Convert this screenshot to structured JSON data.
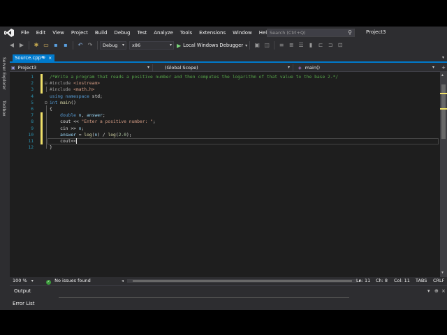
{
  "menu": {
    "items": [
      "File",
      "Edit",
      "View",
      "Project",
      "Build",
      "Debug",
      "Test",
      "Analyze",
      "Tools",
      "Extensions",
      "Window",
      "Help"
    ],
    "search_placeholder": "Search (Ctrl+Q)",
    "project_name": "Project3"
  },
  "toolbar": {
    "config": "Debug",
    "platform": "x86",
    "run_label": "Local Windows Debugger"
  },
  "side": {
    "server_explorer": "Server Explorer",
    "toolbox": "Toolbox"
  },
  "tab": {
    "label": "Source.cpp*",
    "pin": "⊕",
    "close": "×"
  },
  "navbar": {
    "project": "Project3",
    "scope": "(Global Scope)",
    "member": "main()"
  },
  "editor": {
    "line_numbers": [
      "1",
      "2",
      "3",
      "4",
      "5",
      "6",
      "7",
      "8",
      "9",
      "10",
      "11",
      "12"
    ],
    "lines": [
      "/*Write a program that reads a positive number and then computes the logarithm of that value to the base 2.*/",
      "#include <iostream>",
      "#include <math.h>",
      "using namespace std;",
      "int main()",
      "{",
      "    double n, answer;",
      "    cout << \"Enter a positive number: \";",
      "    cin >> n;",
      "    answer = log(n) / log(2.0);",
      "    cout<<",
      "}"
    ],
    "current_line": 11
  },
  "status": {
    "zoom": "100 %",
    "issues": "No issues found",
    "ln": "Ln: 11",
    "ch": "Ch: 8",
    "col": "Col: 11",
    "tabs": "TABS",
    "eol": "CRLF"
  },
  "panels": {
    "output": "Output",
    "error_list": "Error List"
  },
  "colors": {
    "accent": "#007acc",
    "background": "#1e1e1e",
    "chrome": "#2d2d30",
    "comment": "#57a64a",
    "keyword": "#569cd6",
    "string": "#d69d85",
    "line_number": "#2b91af",
    "change_marker": "#efe06a"
  }
}
